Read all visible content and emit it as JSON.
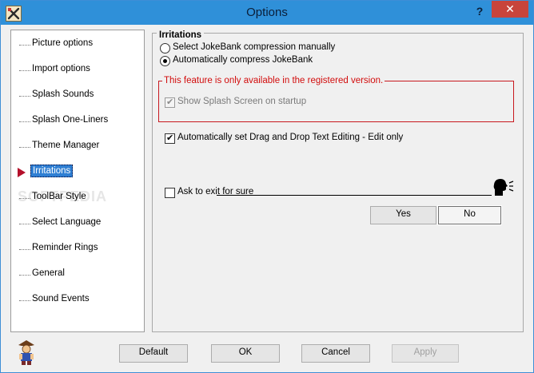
{
  "window": {
    "title": "Options",
    "help_glyph": "?",
    "close_glyph": "✕"
  },
  "nav": {
    "items": [
      {
        "label": "Picture options"
      },
      {
        "label": "Import options"
      },
      {
        "label": "Splash Sounds"
      },
      {
        "label": "Splash One-Liners"
      },
      {
        "label": "Theme Manager"
      },
      {
        "label": "Irritations",
        "active": true
      },
      {
        "label": "ToolBar Style"
      },
      {
        "label": "Select Language"
      },
      {
        "label": "Reminder Rings"
      },
      {
        "label": "General"
      },
      {
        "label": "Sound Events"
      }
    ],
    "watermark": "SOFTPEDIA"
  },
  "irritations": {
    "group_title": "Irritations",
    "radio_manual": "Select JokeBank compression manually",
    "radio_auto": "Automatically compress JokeBank",
    "selected": "auto",
    "registered_notice": "This feature is only available in the registered version.",
    "show_splash": {
      "label": "Show Splash Screen on startup",
      "checked": true,
      "enabled": false
    },
    "drag_drop": {
      "label": "Automatically set Drag and Drop Text Editing - Edit only",
      "checked": true
    },
    "ask_exit": {
      "label": "Ask to exit for sure",
      "checked": false
    },
    "yes_label": "Yes",
    "no_label": "No"
  },
  "footer": {
    "default_label": "Default",
    "ok_label": "OK",
    "cancel_label": "Cancel",
    "apply_label": "Apply"
  },
  "colors": {
    "titlebar": "#2f90d9",
    "close": "#c8443b",
    "selection": "#2f7fd3",
    "notice": "#d20c0c"
  },
  "icons": [
    "app-tools-icon",
    "help-icon",
    "close-icon",
    "pointer-arrow-icon",
    "speaker-head-icon",
    "jester-mascot-icon"
  ]
}
